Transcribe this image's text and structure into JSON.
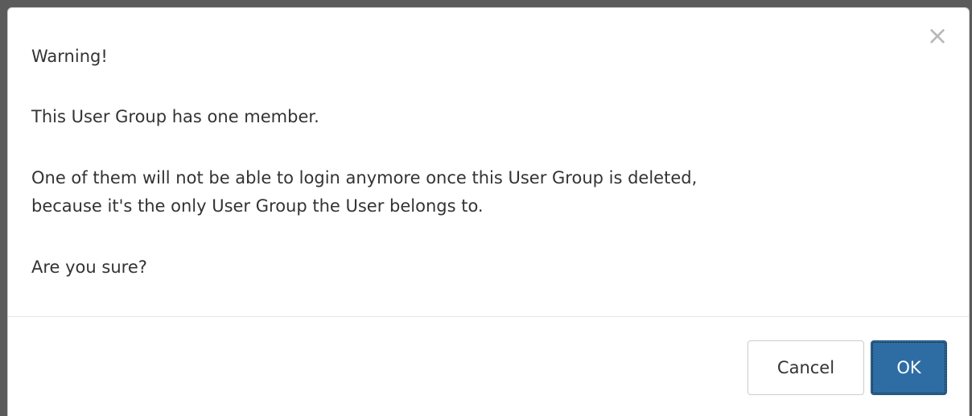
{
  "dialog": {
    "title": "Warning!",
    "message_line_1": "This User Group has one member.",
    "message_line_2": "One of them will not be able to login anymore once this User Group is deleted,",
    "message_line_3": "because it's the only User Group the User belongs to.",
    "question": "Are you sure?",
    "close_glyph": "×",
    "cancel_label": "Cancel",
    "ok_label": "OK"
  },
  "colors": {
    "primary_button": "#2e6da4",
    "text": "#333333",
    "close_icon": "#b8b8b8"
  },
  "icons": {
    "close": "close-icon"
  }
}
